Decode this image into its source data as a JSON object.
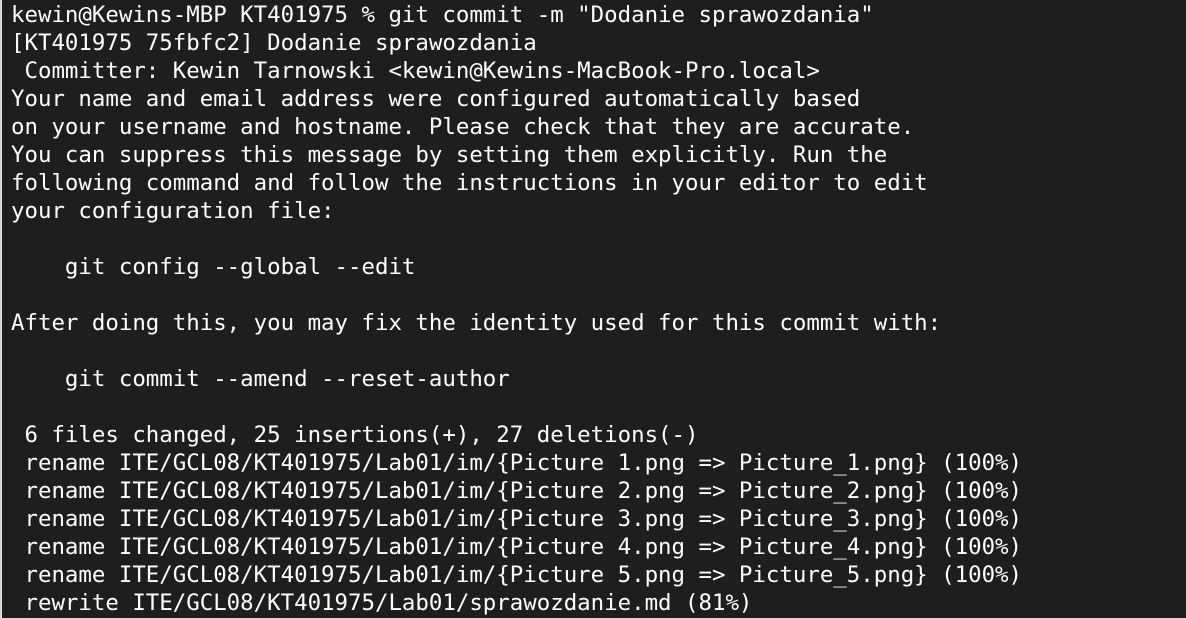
{
  "terminal": {
    "lines": [
      "kewin@Kewins-MBP KT401975 % git commit -m \"Dodanie sprawozdania\"",
      "[KT401975 75fbfc2] Dodanie sprawozdania",
      " Committer: Kewin Tarnowski <kewin@Kewins-MacBook-Pro.local>",
      "Your name and email address were configured automatically based",
      "on your username and hostname. Please check that they are accurate.",
      "You can suppress this message by setting them explicitly. Run the",
      "following command and follow the instructions in your editor to edit",
      "your configuration file:",
      "",
      "    git config --global --edit",
      "",
      "After doing this, you may fix the identity used for this commit with:",
      "",
      "    git commit --amend --reset-author",
      "",
      " 6 files changed, 25 insertions(+), 27 deletions(-)",
      " rename ITE/GCL08/KT401975/Lab01/im/{Picture 1.png => Picture_1.png} (100%)",
      " rename ITE/GCL08/KT401975/Lab01/im/{Picture 2.png => Picture_2.png} (100%)",
      " rename ITE/GCL08/KT401975/Lab01/im/{Picture 3.png => Picture_3.png} (100%)",
      " rename ITE/GCL08/KT401975/Lab01/im/{Picture 4.png => Picture_4.png} (100%)",
      " rename ITE/GCL08/KT401975/Lab01/im/{Picture 5.png => Picture_5.png} (100%)",
      " rewrite ITE/GCL08/KT401975/Lab01/sprawozdanie.md (81%)"
    ]
  },
  "colors": {
    "background": "#1e1e1e",
    "text": "#ffffff"
  }
}
